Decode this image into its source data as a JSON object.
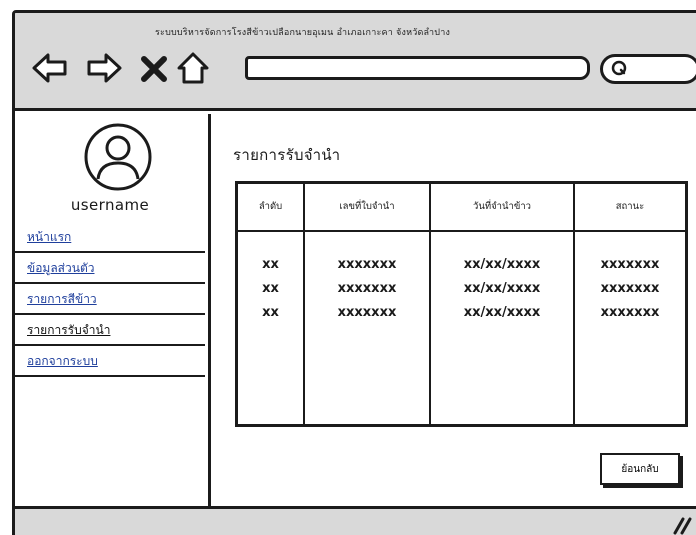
{
  "window": {
    "title": "ระบบบริหารจัดการโรงสีข้าวเปลือกนายอุเมน อำเภอเกาะคา จังหวัดลำปาง",
    "icons": {
      "back": "arrow-left-icon",
      "forward": "arrow-right-icon",
      "stop": "close-icon",
      "home": "home-icon",
      "search": "search-icon",
      "resize": "resize-grip-icon"
    }
  },
  "address_bar": {
    "value": ""
  },
  "search": {
    "value": ""
  },
  "sidebar": {
    "username": "username",
    "items": [
      {
        "label": "หน้าแรก",
        "active": false
      },
      {
        "label": "ข้อมูลส่วนตัว",
        "active": false
      },
      {
        "label": "รายการสีข้าว",
        "active": false
      },
      {
        "label": "รายการรับจำนำ",
        "active": true
      },
      {
        "label": "ออกจากระบบ",
        "active": false
      }
    ]
  },
  "main": {
    "title": "รายการรับจำนำ",
    "table": {
      "headers": [
        "ลำดับ",
        "เลขที่ใบจำนำ",
        "วันที่จำนำข้าว",
        "สถานะ"
      ],
      "rows": [
        [
          "xx",
          "xxxxxxx",
          "xx/xx/xxxx",
          "xxxxxxx"
        ],
        [
          "xx",
          "xxxxxxx",
          "xx/xx/xxxx",
          "xxxxxxx"
        ],
        [
          "xx",
          "xxxxxxx",
          "xx/xx/xxxx",
          "xxxxxxx"
        ]
      ]
    },
    "back_button": "ย้อนกลับ"
  },
  "colors": {
    "chrome": "#d9d9d9",
    "outline": "#1b1b1b",
    "link": "#1f3f9c"
  }
}
